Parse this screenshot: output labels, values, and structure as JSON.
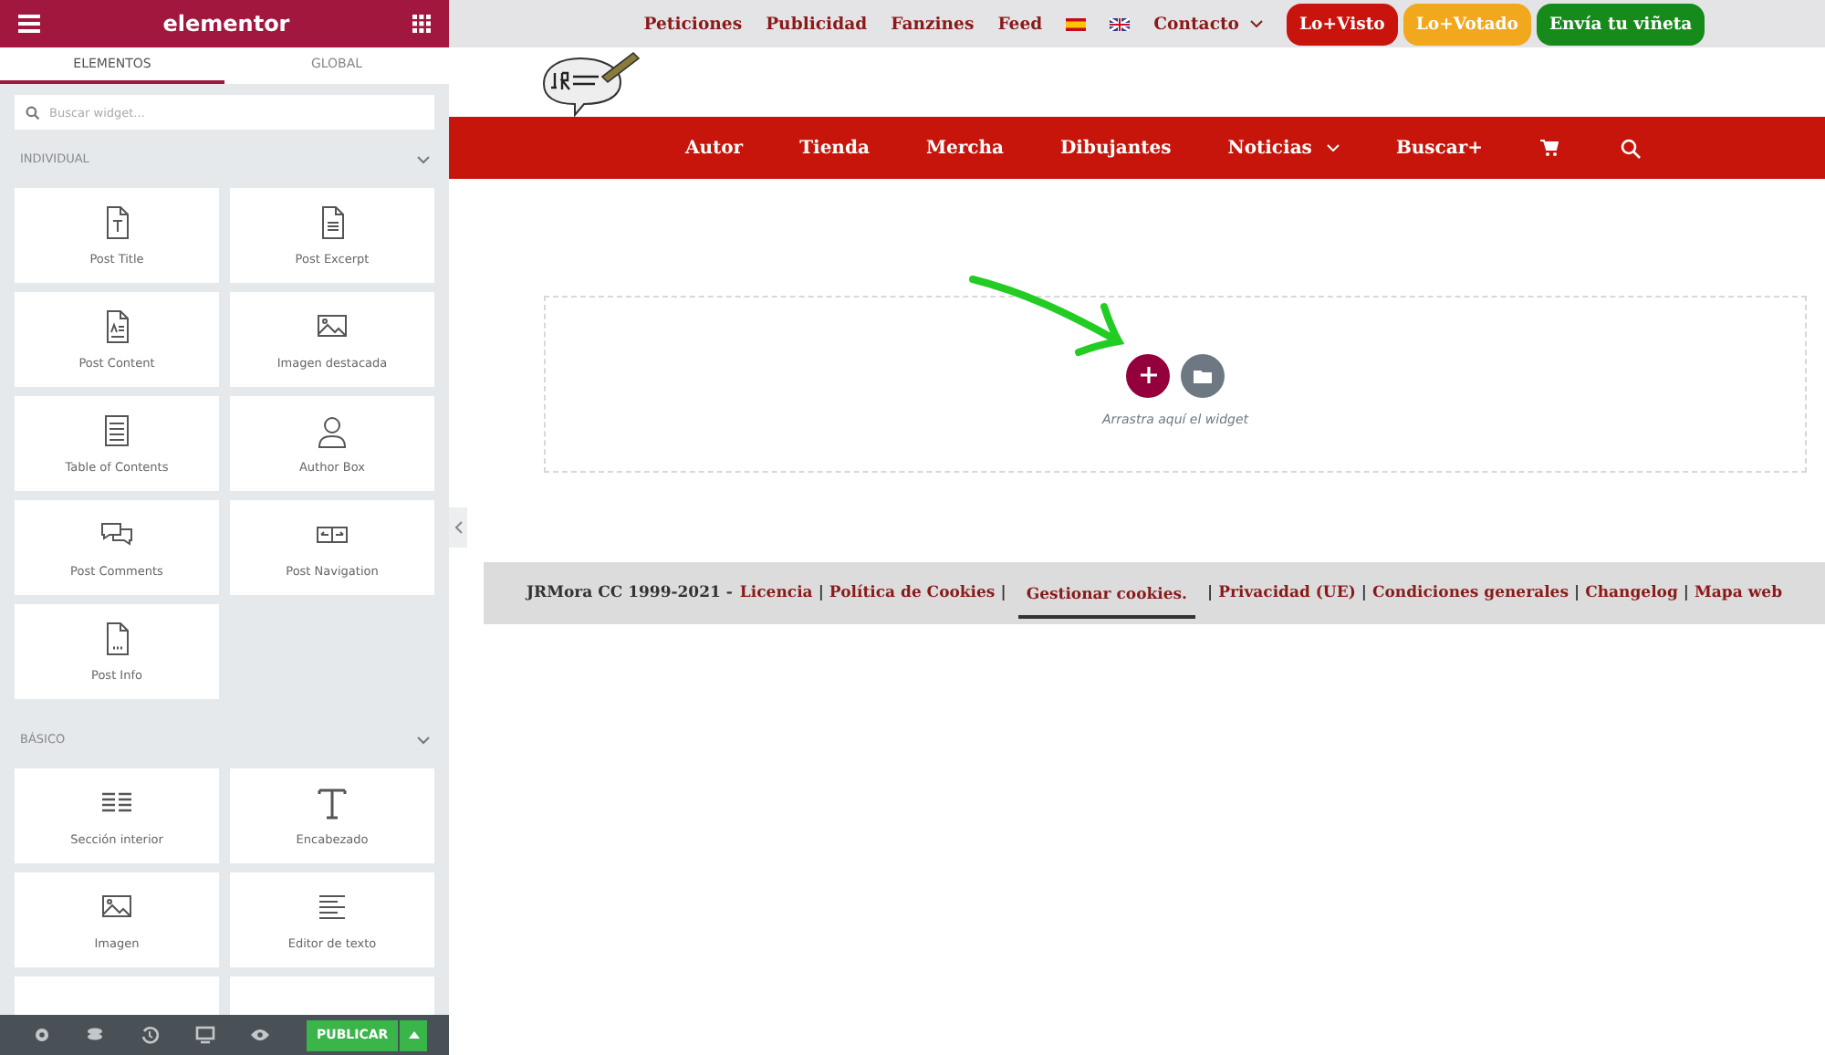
{
  "panel": {
    "title": "elementor",
    "tabs": [
      {
        "label": "ELEMENTOS",
        "selected": true
      },
      {
        "label": "GLOBAL",
        "selected": false
      }
    ],
    "search": {
      "placeholder": "Buscar widget..."
    },
    "sections": [
      {
        "title": "INDIVIDUAL",
        "expanded": true,
        "widgets": [
          {
            "kind": "widget",
            "label": "Post Title"
          },
          {
            "kind": "widget",
            "label": "Post Excerpt"
          },
          {
            "kind": "widget",
            "label": "Post Content"
          },
          {
            "kind": "widget",
            "label": "Imagen destacada"
          },
          {
            "kind": "widget",
            "label": "Table of Contents"
          },
          {
            "kind": "widget",
            "label": "Author Box"
          },
          {
            "kind": "widget",
            "label": "Post Comments"
          },
          {
            "kind": "widget",
            "label": "Post Navigation"
          },
          {
            "kind": "widget",
            "label": "Post Info"
          }
        ]
      },
      {
        "title": "BÁSICO",
        "expanded": true,
        "widgets": [
          {
            "kind": "widget",
            "label": "Sección interior"
          },
          {
            "kind": "widget",
            "label": "Encabezado"
          },
          {
            "kind": "widget",
            "label": "Imagen"
          },
          {
            "kind": "widget",
            "label": "Editor de texto"
          },
          {
            "kind": "cut"
          },
          {
            "kind": "cut"
          }
        ]
      }
    ],
    "footer": {
      "publish": "PUBLICAR"
    }
  },
  "site": {
    "topbar": {
      "links": [
        {
          "kind": "link",
          "label": "Peticiones"
        },
        {
          "kind": "link",
          "label": "Publicidad"
        },
        {
          "kind": "link",
          "label": "Fanzines"
        },
        {
          "kind": "link",
          "label": "Feed"
        },
        {
          "kind": "flag-es"
        },
        {
          "kind": "flag-uk"
        },
        {
          "kind": "dropdown",
          "label": "Contacto"
        }
      ],
      "buttons": [
        {
          "label": "Lo+Visto",
          "color": "#c8140c"
        },
        {
          "label": "Lo+Votado",
          "color": "#f2a81d"
        },
        {
          "label": "Envía tu viñeta",
          "color": "#178a1c"
        }
      ]
    },
    "nav": [
      {
        "kind": "link",
        "label": "Autor"
      },
      {
        "kind": "link",
        "label": "Tienda"
      },
      {
        "kind": "link",
        "label": "Mercha"
      },
      {
        "kind": "link",
        "label": "Dibujantes"
      },
      {
        "kind": "dropdown",
        "label": "Noticias"
      },
      {
        "kind": "link",
        "label": "Buscar+"
      },
      {
        "kind": "cart"
      },
      {
        "kind": "search"
      }
    ],
    "dropzone": {
      "hint": "Arrastra aquí el widget"
    },
    "footer": {
      "prefix": "JRMora CC 1999-2021 -",
      "separator": "|",
      "links": [
        {
          "kind": "link",
          "label": "Licencia"
        },
        {
          "kind": "link",
          "label": "Política de Cookies"
        },
        {
          "kind": "button",
          "label": "Gestionar cookies."
        },
        {
          "kind": "link",
          "label": "Privacidad (UE)"
        },
        {
          "kind": "link",
          "label": "Condiciones generales"
        },
        {
          "kind": "link",
          "label": "Changelog"
        },
        {
          "kind": "link",
          "label": "Mapa web"
        }
      ]
    }
  }
}
